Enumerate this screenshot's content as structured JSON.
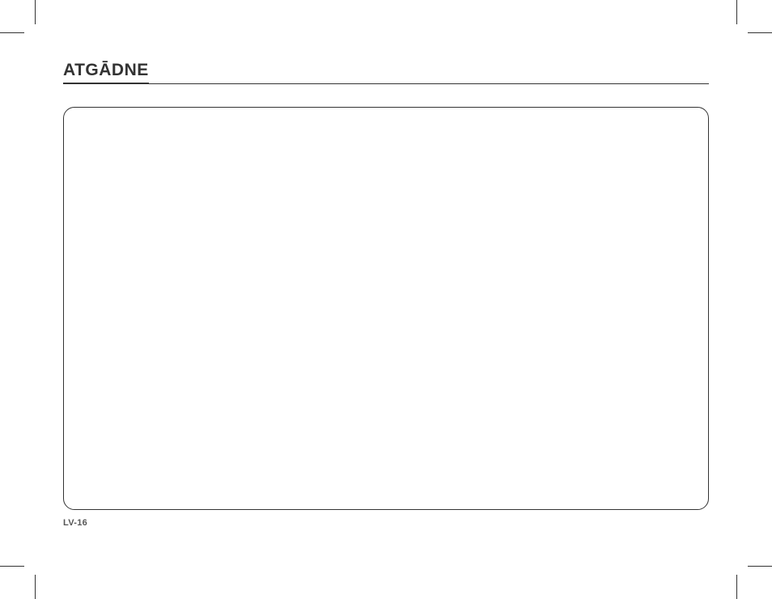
{
  "heading": "ATGĀDNE",
  "page_number": "LV-16"
}
